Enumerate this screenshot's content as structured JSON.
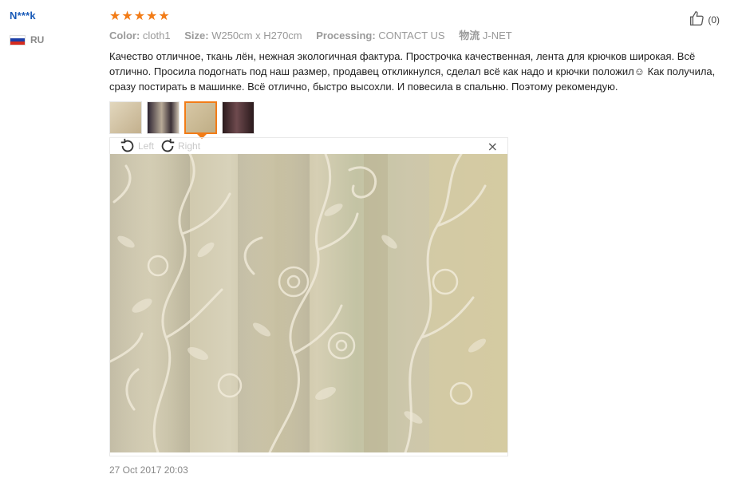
{
  "reviewer": {
    "name": "N***k",
    "country_code": "RU",
    "flag_colors": [
      "#ffffff",
      "#1c3fa8",
      "#d52b1e"
    ]
  },
  "review": {
    "rating": 5,
    "stars": [
      "★",
      "★",
      "★",
      "★",
      "★"
    ],
    "star_color": "#f27c17",
    "attributes": [
      {
        "key": "Color:",
        "value": "cloth1"
      },
      {
        "key": "Size:",
        "value": "W250cm x H270cm"
      },
      {
        "key": "Processing:",
        "value": "CONTACT US"
      },
      {
        "key": "物流",
        "value": "J-NET"
      }
    ],
    "text": "Качество отличное, ткань лён, нежная экологичная фактура. Прострочка качественная, лента для крючков широкая. Всё отлично. Просила подогнать под наш размер, продавец откликнулся, сделал всё как надо и крючки положил☺ Как получила, сразу постирать в машинке. Всё отлично, быстро высохли. И повесила в спальню. Поэтому рекомендую.",
    "date": "27 Oct 2017 20:03"
  },
  "helpful": {
    "count_label": "(0)",
    "icon": "thumbs-up-icon"
  },
  "viewer": {
    "rotate_left_label": "Left",
    "rotate_right_label": "Right",
    "close_glyph": "×",
    "active_thumbnail": 3,
    "thumbnails": [
      {
        "colors": [
          "#d8cbb0",
          "#c3b08d"
        ]
      },
      {
        "colors": [
          "#2b2230",
          "#a89a8a"
        ]
      },
      {
        "colors": [
          "#d7c7a5",
          "#bfae86"
        ]
      },
      {
        "colors": [
          "#2a1a1c",
          "#5e3a3e"
        ]
      }
    ]
  }
}
